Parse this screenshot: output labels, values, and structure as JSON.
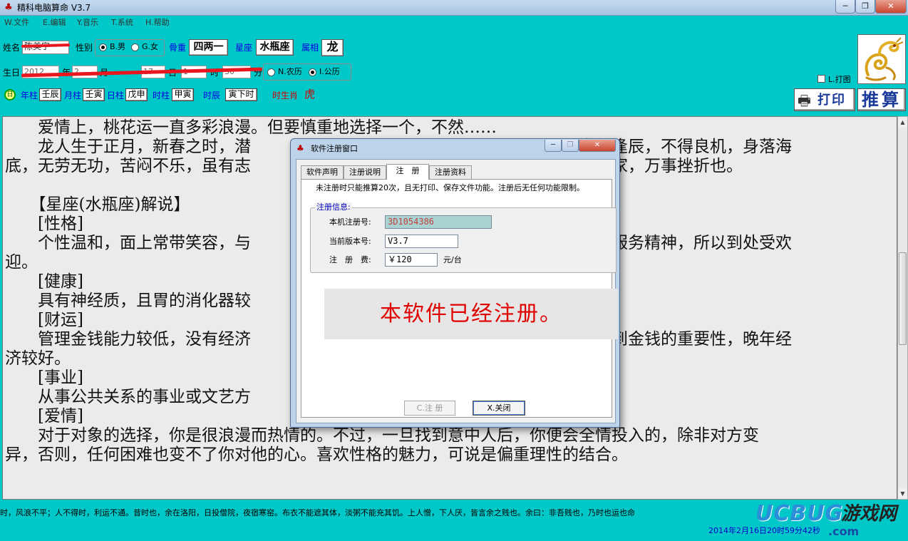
{
  "window": {
    "title": "精科电脑算命 V3.7",
    "minimize": "─",
    "maximize": "❐",
    "close": "✕"
  },
  "menu": [
    {
      "label": "W.文件"
    },
    {
      "label": "E.编辑"
    },
    {
      "label": "Y.音乐"
    },
    {
      "label": "T.系统"
    },
    {
      "label": "H.帮助"
    }
  ],
  "form": {
    "name_label": "姓名",
    "name_value": "陈美宇",
    "gender_label": "性别",
    "gender_male": "B.男",
    "gender_female": "G.女",
    "gender_selected": "male",
    "bone_weight_label": "骨重",
    "bone_weight_value": "四两一",
    "constellation_label": "星座",
    "constellation_value": "水瓶座",
    "zodiac_label": "属相",
    "zodiac_value": "龙",
    "birth_label": "生日",
    "year_value": "2012",
    "year_unit": "年",
    "month_value": "2",
    "month_unit": "月",
    "day_value": "17",
    "day_unit": "日",
    "hour_value": "1",
    "hour_unit": "时",
    "minute_value": "30",
    "minute_unit": "分",
    "calendar_lunar": "N.农历",
    "calendar_solar": "I.公历",
    "calendar_selected": "solar",
    "print_chart_label": "L.打图"
  },
  "pillars": {
    "marker": "日",
    "year_label": "年柱",
    "year_value": "壬辰",
    "month_label": "月柱",
    "month_value": "壬寅",
    "day_label": "日柱",
    "day_value": "戊申",
    "hour_label": "时柱",
    "hour_value": "甲寅",
    "shichen_label": "时辰",
    "shichen_value": "寅下时",
    "hour_zodiac_label": "时生肖",
    "hour_zodiac_value": "虎"
  },
  "buttons": {
    "print": "打印",
    "calculate": "推算"
  },
  "result_lines": [
    "　　爱情上，桃花运一直多彩浪漫。但要慎重地选择一个，不然……",
    "　　龙人生于正月，新春之时，潜　　　　　　　　　　　　　　　　　　　，生不逢辰，不得良机，身落海",
    "底，无劳无功，苦闷不乐，虽有志　　　　　　　　　　　　　　　　　　　淡薄成家，万事挫折也。",
    "",
    "　　【星座(水瓶座)解说】",
    "　　[性格]",
    "　　个性温和，面上常带笑容，与　　　　　　　　　　　　　　　　　　　有社会服务精神，所以到处受欢",
    "迎。",
    "　　[健康]",
    "　　具有神经质，且胃的消化器较",
    "　　[财运]",
    "　　管理金钱能力较低，没有经济　　　　　　　　　　　　　　　　　　　渐认识到金钱的重要性，晚年经",
    "济较好。",
    "　　[事业]",
    "　　从事公共关系的事业或文艺方",
    "　　[爱情]",
    "　　对于对象的选择，你是很浪漫而热情的。不过，一旦找到意中人后，你便会全情投入的，除非对方变",
    "异，否则，任何困难也变不了你对他的心。喜欢性格的魅力，可说是偏重理性的结合。"
  ],
  "marquee_text": "时，风浪不平；人不得时，利运不通。昔时也，余在洛阳，日投僧院，夜宿寒窑。布衣不能遮其体，淡粥不能充其饥。上人憎，下人厌，皆言余之贱也。余曰：非吾贱也，乃时也运也命",
  "status_time": "2014年2月16日20时59分42秒",
  "watermark": {
    "brand": "UCBUG",
    "cn": "游戏网",
    "sub": ".com"
  },
  "dialog": {
    "title": "软件注册窗口",
    "tabs": [
      {
        "label": "软件声明"
      },
      {
        "label": "注册说明"
      },
      {
        "label": "注　册"
      },
      {
        "label": "注册资料"
      }
    ],
    "active_tab": 2,
    "notice": "未注册时只能推算20次，且无打印、保存文件功能。注册后无任何功能限制。",
    "group_title": "注册信息:",
    "machine_id_label": "本机注册号:",
    "machine_id_value": "3D1054386",
    "version_label": "当前版本号:",
    "version_value": "V3.7",
    "fee_label": "注　册　费:",
    "fee_value": "￥120",
    "fee_unit": "元/台",
    "registered_message": "本软件已经注册。",
    "register_button": "C.注 册",
    "close_button": "X.关闭"
  },
  "colors": {
    "background": "#00c8c8",
    "label_blue": "#0000e0",
    "label_red": "#d00000",
    "registered_red": "#e00000"
  }
}
